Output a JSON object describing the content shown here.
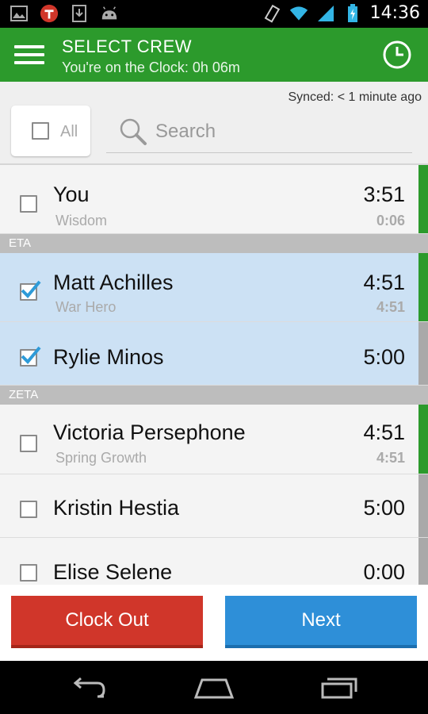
{
  "status_bar": {
    "time": "14:36",
    "left_icons": [
      "image-icon",
      "t-logo-icon",
      "download-icon",
      "android-icon"
    ],
    "right_icons": [
      "vibrate-icon",
      "wifi-icon",
      "signal-icon",
      "battery-icon"
    ]
  },
  "app_bar": {
    "title": "SELECT CREW",
    "subtitle": "You're on the Clock: 0h 06m",
    "color": "#2c9a2c"
  },
  "sync": {
    "text": "Synced: < 1 minute ago"
  },
  "select_all": {
    "label": "All"
  },
  "search": {
    "placeholder": "Search"
  },
  "crew": [
    {
      "name": "You",
      "subtitle": "Wisdom",
      "time": "3:51",
      "subtime": "0:06",
      "checked": false,
      "bar": "green"
    },
    {
      "section": "ETA"
    },
    {
      "name": "Matt Achilles",
      "subtitle": "War Hero",
      "time": "4:51",
      "subtime": "4:51",
      "checked": true,
      "bar": "green"
    },
    {
      "name": "Rylie Minos",
      "time": "5:00",
      "checked": true,
      "bar": "gray"
    },
    {
      "section": "ZETA"
    },
    {
      "name": "Victoria Persephone",
      "subtitle": "Spring Growth",
      "time": "4:51",
      "subtime": "4:51",
      "checked": false,
      "bar": "green"
    },
    {
      "name": "Kristin Hestia",
      "time": "5:00",
      "checked": false,
      "bar": "gray"
    },
    {
      "name": "Elise Selene",
      "time": "0:00",
      "checked": false,
      "bar": "gray"
    }
  ],
  "buttons": {
    "clock_out": "Clock Out",
    "next": "Next"
  },
  "colors": {
    "clock_out": "#d0362a",
    "next": "#2e8fd8",
    "selected_row": "#cce1f4",
    "green_bar": "#2c9a2c",
    "gray_bar": "#a9a9a9"
  }
}
